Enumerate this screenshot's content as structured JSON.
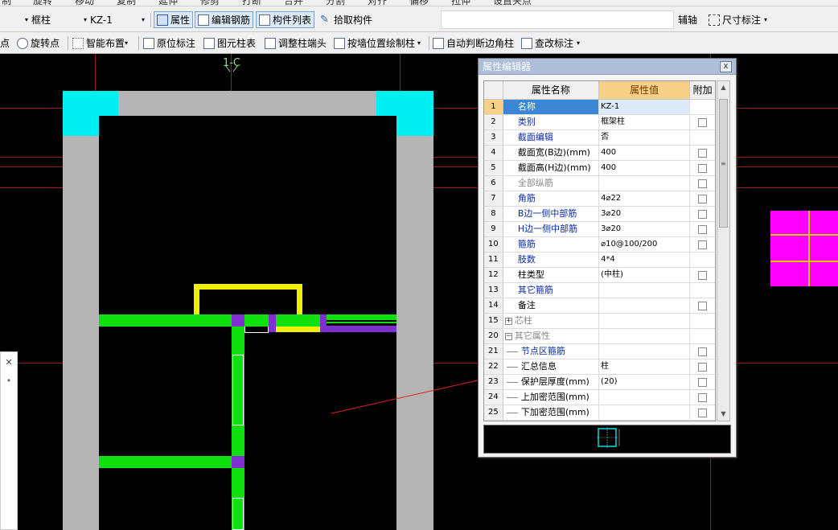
{
  "toolbar_top_partial": [
    "制",
    "旋转",
    "移动",
    "复制",
    "延伸",
    "修剪",
    "打断",
    "合并",
    "分割",
    "对齐",
    "偏移",
    "拉伸",
    "设置夹点"
  ],
  "toolbar1": {
    "type_select": "框柱",
    "name_select": "KZ-1",
    "buttons": [
      "属性",
      "编辑钢筋",
      "构件列表",
      "拾取构件"
    ],
    "right_partial": "辅轴",
    "dimension": "尺寸标注"
  },
  "toolbar2": {
    "items": [
      "点",
      "旋转点",
      "智能布置",
      "原位标注",
      "图元柱表",
      "调整柱端头",
      "按墙位置绘制柱",
      "自动判断边角柱",
      "查改标注"
    ]
  },
  "axis_label": "1-C",
  "dialog": {
    "title": "属性编辑器",
    "close": "x",
    "headers": {
      "num": "",
      "name": "属性名称",
      "value": "属性值",
      "extra": "附加"
    },
    "rows": [
      {
        "num": "1",
        "name": "名称",
        "value": "KZ-1",
        "check": false,
        "color": "blue"
      },
      {
        "num": "2",
        "name": "类别",
        "value": "框架柱",
        "check": true,
        "color": "blue"
      },
      {
        "num": "3",
        "name": "截面编辑",
        "value": "否",
        "check": false,
        "color": "blue"
      },
      {
        "num": "4",
        "name": "截面宽(B边)(mm)",
        "value": "400",
        "check": true,
        "color": "black"
      },
      {
        "num": "5",
        "name": "截面高(H边)(mm)",
        "value": "400",
        "check": true,
        "color": "black"
      },
      {
        "num": "6",
        "name": "全部纵筋",
        "value": "",
        "check": true,
        "color": "gray"
      },
      {
        "num": "7",
        "name": "角筋",
        "value": "4⌀22",
        "check": true,
        "color": "blue"
      },
      {
        "num": "8",
        "name": "B边一侧中部筋",
        "value": "3⌀20",
        "check": true,
        "color": "blue"
      },
      {
        "num": "9",
        "name": "H边一侧中部筋",
        "value": "3⌀20",
        "check": true,
        "color": "blue"
      },
      {
        "num": "10",
        "name": "箍筋",
        "value": "⌀10@100/200",
        "check": true,
        "color": "blue"
      },
      {
        "num": "11",
        "name": "肢数",
        "value": "4*4",
        "check": false,
        "color": "blue"
      },
      {
        "num": "12",
        "name": "柱类型",
        "value": "(中柱)",
        "check": true,
        "color": "black"
      },
      {
        "num": "13",
        "name": "其它箍筋",
        "value": "",
        "check": false,
        "color": "blue"
      },
      {
        "num": "14",
        "name": "备注",
        "value": "",
        "check": true,
        "color": "black"
      },
      {
        "num": "15",
        "name": "芯柱",
        "value": "",
        "check": false,
        "color": "gray",
        "expander": "+"
      },
      {
        "num": "20",
        "name": "其它属性",
        "value": "",
        "check": false,
        "color": "gray",
        "expander": "−"
      },
      {
        "num": "21",
        "name": "节点区箍筋",
        "value": "",
        "check": true,
        "color": "blue",
        "tree": true
      },
      {
        "num": "22",
        "name": "汇总信息",
        "value": "柱",
        "check": true,
        "color": "black",
        "tree": true
      },
      {
        "num": "23",
        "name": "保护层厚度(mm)",
        "value": "(20)",
        "check": true,
        "color": "black",
        "tree": true
      },
      {
        "num": "24",
        "name": "上加密范围(mm)",
        "value": "",
        "check": true,
        "color": "black",
        "tree": true
      },
      {
        "num": "25",
        "name": "下加密范围(mm)",
        "value": "",
        "check": true,
        "color": "black",
        "tree": true
      }
    ]
  },
  "colors": {
    "cyan": "#00f0f0",
    "gray_wall": "#b4b4b4",
    "green": "#10e010",
    "yellow": "#f0f000",
    "purple": "#8030d0",
    "magenta": "#ff00ff",
    "axis_red": "#a01818"
  }
}
